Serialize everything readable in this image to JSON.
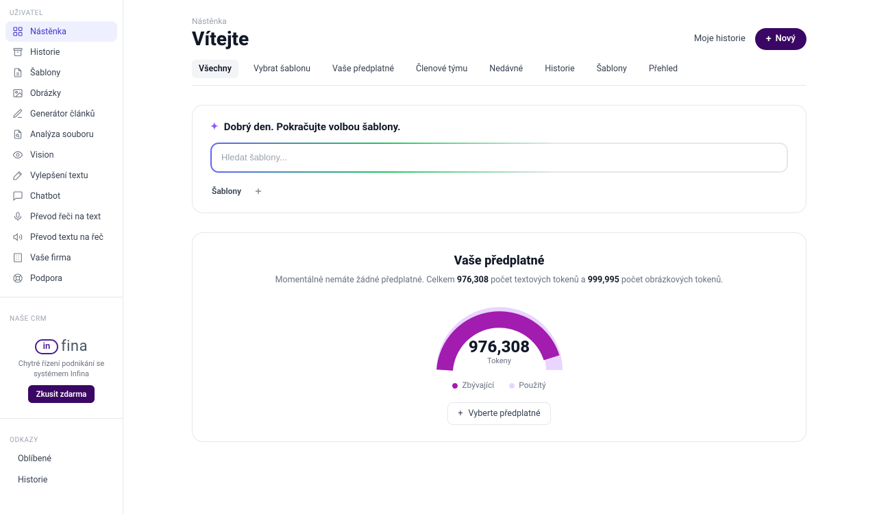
{
  "sidebar": {
    "section_user": "UŽIVATEL",
    "items": [
      {
        "label": "Nástěnka"
      },
      {
        "label": "Historie"
      },
      {
        "label": "Šablony"
      },
      {
        "label": "Obrázky"
      },
      {
        "label": "Generátor článků"
      },
      {
        "label": "Analýza souboru"
      },
      {
        "label": "Vision"
      },
      {
        "label": "Vylepšení textu"
      },
      {
        "label": "Chatbot"
      },
      {
        "label": "Převod řeči na text"
      },
      {
        "label": "Převod textu na řeč"
      },
      {
        "label": "Vaše firma"
      },
      {
        "label": "Podpora"
      }
    ],
    "section_crm": "NAŠE CRM",
    "crm": {
      "logo_in": "in",
      "logo_fina": "fina",
      "desc": "Chytré řízení podnikání se systémem Infina",
      "cta": "Zkusit zdarma"
    },
    "section_links": "ODKAZY",
    "links": [
      {
        "label": "Oblíbené"
      },
      {
        "label": "Historie"
      }
    ]
  },
  "header": {
    "breadcrumb": "Nástěnka",
    "title": "Vítejte",
    "my_history": "Moje historie",
    "new_button": "Nový"
  },
  "tabs": [
    "Všechny",
    "Vybrat šablonu",
    "Vaše předplatné",
    "Členové týmu",
    "Nedávné",
    "Historie",
    "Šablony",
    "Přehled"
  ],
  "search_card": {
    "hello": "Dobrý den. Pokračujte volbou šablony.",
    "placeholder": "Hledat šablony...",
    "templates_label": "Šablony"
  },
  "subscription": {
    "title": "Vaše předplatné",
    "desc_prefix": "Momentálně nemáte žádné předplatné. Celkem ",
    "text_tokens": "976,308",
    "desc_mid": " počet textových tokenů a ",
    "image_tokens": "999,995",
    "desc_suffix": " počet obrázkových tokenů.",
    "gauge_value": "976,308",
    "gauge_label": "Tokeny",
    "legend_remaining": "Zbývající",
    "legend_used": "Použitý",
    "choose_button": "Vyberte předplatné"
  },
  "chart_data": {
    "type": "pie",
    "title": "Tokeny",
    "categories": [
      "Zbývající",
      "Použitý"
    ],
    "values": [
      976308,
      23692
    ],
    "series": [
      {
        "name": "Zbývající",
        "values": [
          976308
        ],
        "color": "#a21caf"
      },
      {
        "name": "Použitý",
        "values": [
          23692
        ],
        "color": "#e9d5ff"
      }
    ],
    "total_hint": 1000000,
    "display": "semi-donut",
    "center_value": 976308,
    "center_label": "Tokeny"
  }
}
